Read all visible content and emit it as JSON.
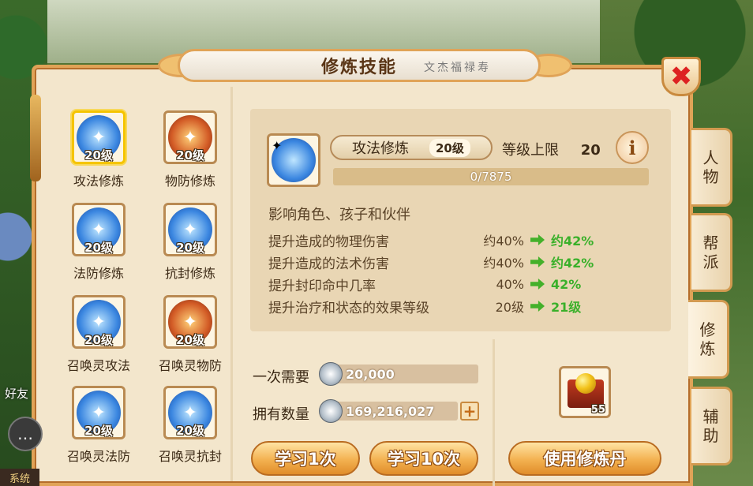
{
  "window": {
    "title": "修炼技能",
    "title_deco": "文杰福禄寿",
    "close_label": "✖"
  },
  "skills": [
    {
      "name": "攻法修炼",
      "level": "20级",
      "icon": "attack-magic-icon",
      "color": "blue",
      "selected": true
    },
    {
      "name": "物防修炼",
      "level": "20级",
      "icon": "physical-defense-icon",
      "color": "red",
      "selected": false
    },
    {
      "name": "法防修炼",
      "level": "20级",
      "icon": "magic-defense-icon",
      "color": "blue",
      "selected": false
    },
    {
      "name": "抗封修炼",
      "level": "20级",
      "icon": "seal-resist-icon",
      "color": "blue",
      "selected": false
    },
    {
      "name": "召唤灵攻法",
      "level": "20级",
      "icon": "summon-attack-icon",
      "color": "blue",
      "selected": false
    },
    {
      "name": "召唤灵物防",
      "level": "20级",
      "icon": "summon-physical-defense-icon",
      "color": "red",
      "selected": false
    },
    {
      "name": "召唤灵法防",
      "level": "20级",
      "icon": "summon-magic-defense-icon",
      "color": "blue",
      "selected": false
    },
    {
      "name": "召唤灵抗封",
      "level": "20级",
      "icon": "summon-seal-resist-icon",
      "color": "blue",
      "selected": false
    }
  ],
  "detail": {
    "skill_name": "攻法修炼",
    "skill_level": "20级",
    "level_cap_label": "等级上限",
    "level_cap_value": "20",
    "info_label": "i",
    "progress_text": "0/7875",
    "progress_fraction": 0,
    "effect_title": "影响角色、孩子和伙伴",
    "effects": [
      {
        "label": "提升造成的物理伤害",
        "current": "约40%",
        "next": "约42%"
      },
      {
        "label": "提升造成的法术伤害",
        "current": "约40%",
        "next": "约42%"
      },
      {
        "label": "提升封印命中几率",
        "current": "40%",
        "next": "42%"
      },
      {
        "label": "提升治疗和状态的效果等级",
        "current": "20级",
        "next": "21级"
      }
    ]
  },
  "cost": {
    "once_label": "一次需要",
    "once_value": "20,000",
    "own_label": "拥有数量",
    "own_value": "169,216,027",
    "plus_label": "+"
  },
  "buttons": {
    "learn_once": "学习1次",
    "learn_ten": "学习10次",
    "use_pill": "使用修炼丹"
  },
  "pill_item": {
    "quantity": "55"
  },
  "side_tabs": [
    {
      "label": "人物",
      "active": false
    },
    {
      "label": "帮派",
      "active": false
    },
    {
      "label": "修炼",
      "active": true
    },
    {
      "label": "辅助",
      "active": false
    }
  ],
  "hud": {
    "friend": "好友",
    "system": "系统"
  }
}
